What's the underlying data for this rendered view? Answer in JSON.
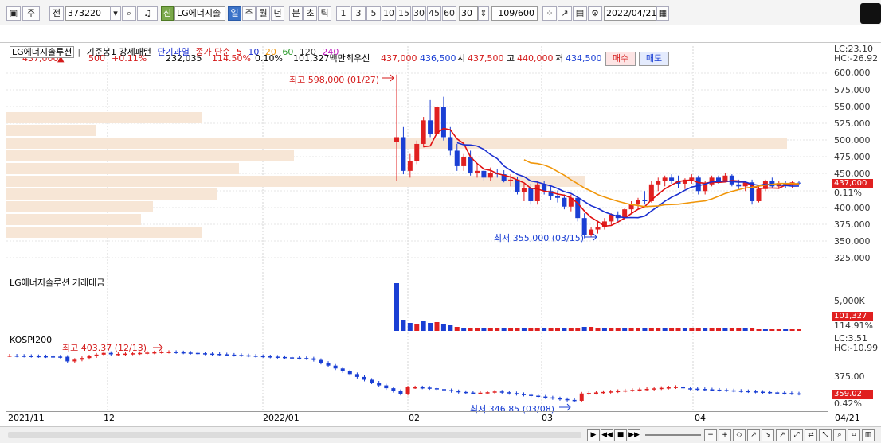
{
  "toolbar": {
    "type_label": "주",
    "prev_label": "전",
    "code": "373220",
    "new_badge": "신",
    "stock_name": "LG에너지솔",
    "periods": [
      "일",
      "주",
      "월",
      "년",
      "분",
      "초",
      "틱"
    ],
    "active_period": "일",
    "intervals": [
      "1",
      "3",
      "5",
      "10",
      "15",
      "30",
      "45",
      "60"
    ],
    "interval_input": "30",
    "count": "109/600",
    "date": "2022/04/21"
  },
  "quote": {
    "price": "437,000",
    "change": "500",
    "change_pct": "+0.11%",
    "volume": "232,035",
    "vol_ratio": "114.50%",
    "turnover_pct": "0.10%",
    "amount": "101,327백만",
    "pref_label": "최우선",
    "pref_price": "437,000",
    "pref_price2": "436,500",
    "open_label": "시",
    "open": "437,500",
    "high_label": "고",
    "high": "440,000",
    "low_label": "저",
    "low": "434,500",
    "buy_label": "매수",
    "sell_label": "매도"
  },
  "price_pane": {
    "legend_name": "LG에너지솔루션",
    "legend_items": [
      "기준봉1 강세패턴",
      "단기과열",
      "종가 단순"
    ],
    "ma_periods": [
      "5",
      "10",
      "20",
      "60",
      "120",
      "240"
    ],
    "lc": "LC:23.10",
    "hc": "HC:-26.92",
    "ticks": [
      "600,000",
      "575,000",
      "550,000",
      "525,000",
      "500,000",
      "475,000",
      "450,000",
      "425,000",
      "400,000",
      "375,000",
      "350,000",
      "325,000"
    ],
    "badge_price": "437,000",
    "badge_pct": "0.11%",
    "high_note": "최고 598,000 (01/27)",
    "low_note": "최저 355,000 (03/15)"
  },
  "volume_pane": {
    "legend": "LG에너지솔루션 거래대금",
    "tick": "5,000K",
    "badge_value": "101,327",
    "badge_pct": "114.91%"
  },
  "index_pane": {
    "legend": "KOSPI200",
    "lc": "LC:3.51",
    "hc": "HC:-10.99",
    "tick": "375,00",
    "badge_value": "359.02",
    "badge_pct": "0.42%",
    "high_note": "최고 403.37 (12/13)",
    "low_note": "최저 346.85 (03/08)"
  },
  "date_axis": [
    "2021/11",
    "12",
    "2022/01",
    "02",
    "03",
    "04",
    "04/21"
  ],
  "colors": {
    "up": "#e02020",
    "down": "#1a3fd4",
    "ma5": "#e01010",
    "ma10": "#1a2fd0",
    "ma20": "#f0960a",
    "volume_profile": "#f7e6d6"
  },
  "chart_data": {
    "type": "candlestick",
    "ylim": [
      310000,
      610000
    ],
    "candles": [
      [
        498000,
        598000,
        440000,
        505000
      ],
      [
        505000,
        520000,
        450000,
        455000
      ],
      [
        455000,
        480000,
        445000,
        470000
      ],
      [
        470000,
        500000,
        465000,
        495000
      ],
      [
        495000,
        535000,
        490000,
        530000
      ],
      [
        530000,
        560000,
        505000,
        510000
      ],
      [
        510000,
        578000,
        505000,
        550000
      ],
      [
        550000,
        565000,
        500000,
        505000
      ],
      [
        505000,
        520000,
        478000,
        485000
      ],
      [
        485000,
        495000,
        455000,
        462000
      ],
      [
        462000,
        480000,
        455000,
        475000
      ],
      [
        475000,
        485000,
        448000,
        452000
      ],
      [
        452000,
        465000,
        445000,
        455000
      ],
      [
        455000,
        460000,
        440000,
        445000
      ],
      [
        445000,
        460000,
        440000,
        452000
      ],
      [
        452000,
        458000,
        445000,
        450000
      ],
      [
        450000,
        456000,
        438000,
        440000
      ],
      [
        440000,
        450000,
        432000,
        442000
      ],
      [
        442000,
        446000,
        420000,
        424000
      ],
      [
        424000,
        436000,
        410000,
        430000
      ],
      [
        430000,
        436000,
        405000,
        410000
      ],
      [
        410000,
        440000,
        405000,
        435000
      ],
      [
        435000,
        440000,
        420000,
        425000
      ],
      [
        425000,
        432000,
        412000,
        418000
      ],
      [
        418000,
        426000,
        408000,
        415000
      ],
      [
        415000,
        420000,
        398000,
        402000
      ],
      [
        402000,
        420000,
        395000,
        415000
      ],
      [
        415000,
        418000,
        380000,
        385000
      ],
      [
        385000,
        392000,
        355000,
        360000
      ],
      [
        360000,
        372000,
        357000,
        368000
      ],
      [
        368000,
        380000,
        362000,
        372000
      ],
      [
        372000,
        385000,
        368000,
        380000
      ],
      [
        380000,
        392000,
        375000,
        390000
      ],
      [
        390000,
        395000,
        380000,
        385000
      ],
      [
        385000,
        400000,
        382000,
        398000
      ],
      [
        398000,
        410000,
        392000,
        405000
      ],
      [
        405000,
        415000,
        398000,
        412000
      ],
      [
        412000,
        425000,
        405000,
        410000
      ],
      [
        410000,
        440000,
        408000,
        435000
      ],
      [
        435000,
        445000,
        425000,
        440000
      ],
      [
        440000,
        448000,
        432000,
        445000
      ],
      [
        445000,
        450000,
        436000,
        440000
      ],
      [
        440000,
        448000,
        430000,
        436000
      ],
      [
        436000,
        444000,
        428000,
        442000
      ],
      [
        442000,
        450000,
        436000,
        445000
      ],
      [
        445000,
        448000,
        420000,
        425000
      ],
      [
        425000,
        440000,
        420000,
        435000
      ],
      [
        435000,
        448000,
        432000,
        445000
      ],
      [
        445000,
        448000,
        436000,
        440000
      ],
      [
        440000,
        452000,
        438000,
        448000
      ],
      [
        448000,
        450000,
        432000,
        435000
      ],
      [
        435000,
        442000,
        428000,
        432000
      ],
      [
        432000,
        440000,
        425000,
        438000
      ],
      [
        438000,
        442000,
        405000,
        410000
      ],
      [
        410000,
        432000,
        408000,
        428000
      ],
      [
        428000,
        442000,
        425000,
        440000
      ],
      [
        440000,
        445000,
        430000,
        432000
      ],
      [
        432000,
        440000,
        428000,
        436000
      ],
      [
        436000,
        440000,
        430000,
        434000
      ],
      [
        434000,
        440000,
        430000,
        438000
      ],
      [
        437500,
        440000,
        434500,
        437000
      ]
    ]
  }
}
